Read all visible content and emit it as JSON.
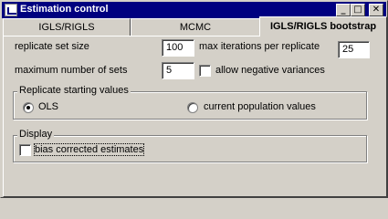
{
  "window": {
    "title": "Estimation control"
  },
  "title_buttons": {
    "minimize": "_",
    "maximize": "□",
    "close": "✕"
  },
  "tabs": [
    {
      "label": "IGLS/RIGLS"
    },
    {
      "label": "MCMC"
    },
    {
      "label": "IGLS/RIGLS bootstrap"
    }
  ],
  "form": {
    "replicate_set_size_label": "replicate set size",
    "replicate_set_size_value": "100",
    "max_iterations_label": "max iterations per replicate",
    "max_iterations_value": "25",
    "maximum_sets_label": "maximum number of sets",
    "maximum_sets_value": "5",
    "allow_negative_label": "allow negative variances"
  },
  "replicate_group": {
    "title": "Replicate starting values",
    "option_ols": "OLS",
    "option_current": "current population values",
    "selected": "OLS"
  },
  "display_group": {
    "title": "Display",
    "bias_corrected_label": "bias corrected estimates"
  }
}
